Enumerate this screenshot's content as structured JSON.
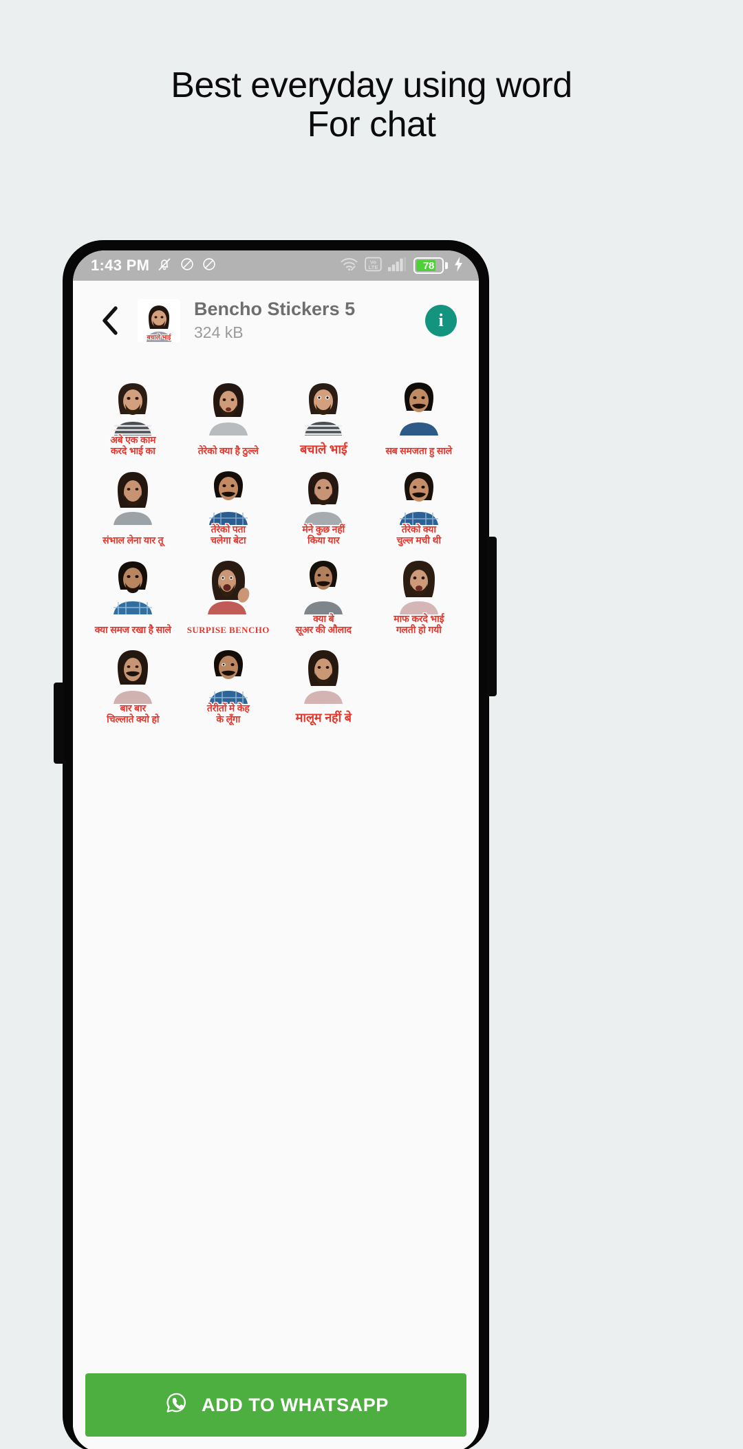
{
  "promo": {
    "line1": "Best everyday using word",
    "line2": "For chat"
  },
  "colors": {
    "page_background": "#eceff0",
    "phone_frame": "#070708",
    "screen_background": "#fafafa",
    "status_bar": "#b3b3b3",
    "info_button": "#13947f",
    "cta_green": "#4caf3f",
    "battery_green": "#4cd137",
    "caption_red": "#e8352b"
  },
  "status_bar": {
    "time": "1:43 PM",
    "left_icons": [
      "notifications-off-icon",
      "do-not-disturb-icon",
      "do-not-disturb-icon"
    ],
    "right_icons": [
      "wifi-icon",
      "volte-icon",
      "signal-bars-icon"
    ],
    "volte_label_top": "Vo",
    "volte_label_bottom": "LTE",
    "battery_percent": "78",
    "charging": true
  },
  "header": {
    "back_icon": "chevron-left-icon",
    "thumbnail_caption": "बचाले भाई",
    "pack_title": "Bencho Stickers 5",
    "pack_size": "324 kB",
    "info_label": "i"
  },
  "stickers": [
    {
      "caption": "अबे एक काम\nकरदे भाई का",
      "script": "devanagari",
      "size": "normal"
    },
    {
      "caption": "तेरेको क्या है ठुल्ले",
      "script": "devanagari",
      "size": "normal"
    },
    {
      "caption": "बचाले भाई",
      "script": "devanagari",
      "size": "big"
    },
    {
      "caption": "सब समजता हु साले",
      "script": "devanagari",
      "size": "normal"
    },
    {
      "caption": "संभाल लेना यार तू",
      "script": "devanagari",
      "size": "normal"
    },
    {
      "caption": "तेरेको पता\nचलेगा बेटा",
      "script": "devanagari",
      "size": "normal"
    },
    {
      "caption": "मेने कुछ नहीं\nकिया यार",
      "script": "devanagari",
      "size": "normal"
    },
    {
      "caption": "तेरेको क्या\nचुल्ल मची थी",
      "script": "devanagari",
      "size": "normal"
    },
    {
      "caption": "क्या समज रखा है साले",
      "script": "devanagari",
      "size": "normal"
    },
    {
      "caption": "SURPISE BENCHO",
      "script": "latin",
      "size": "normal"
    },
    {
      "caption": "क्या बे\nसूअर की औलाद",
      "script": "devanagari",
      "size": "normal"
    },
    {
      "caption": "माफ करदे भाई\nगलती हो गयी",
      "script": "devanagari",
      "size": "normal"
    },
    {
      "caption": "बार बार\nचिल्लाते क्यो हो",
      "script": "devanagari",
      "size": "normal"
    },
    {
      "caption": "तेरीतों मे केह\nके लूँगा",
      "script": "devanagari",
      "size": "normal"
    },
    {
      "caption": "मालूम नहीं बे",
      "script": "devanagari",
      "size": "big"
    }
  ],
  "cta": {
    "icon": "whatsapp-icon",
    "label": "ADD TO WHATSAPP"
  }
}
